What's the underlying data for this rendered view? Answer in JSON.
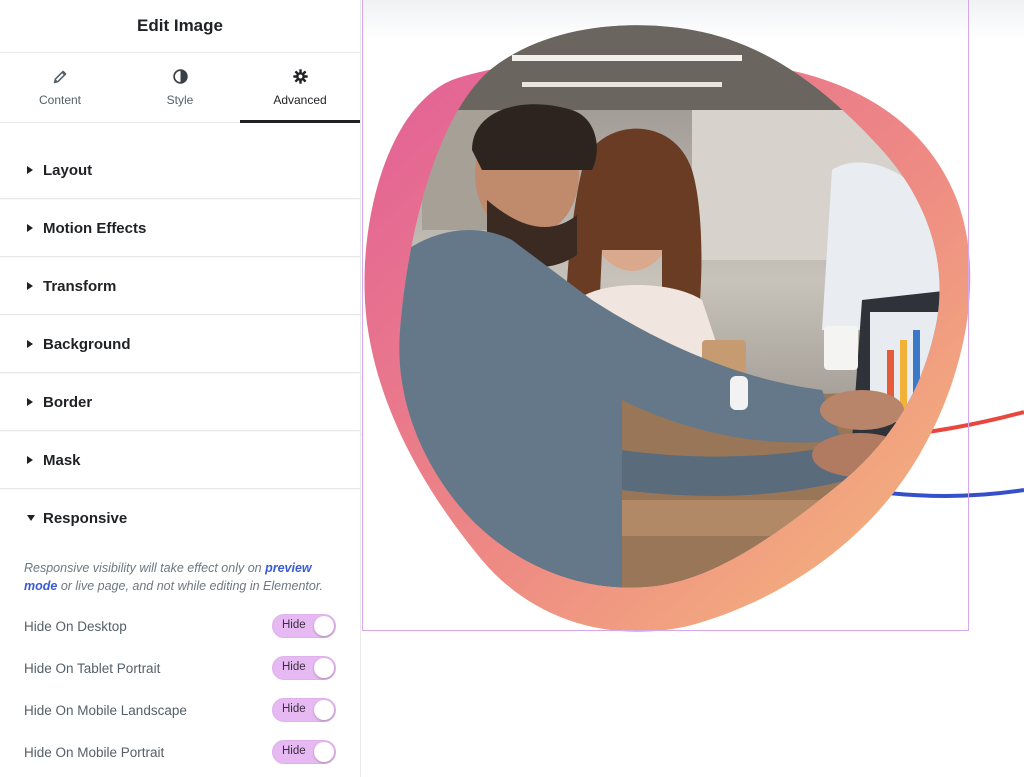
{
  "panel": {
    "title": "Edit Image",
    "tabs": [
      {
        "label": "Content",
        "icon": "pencil-icon"
      },
      {
        "label": "Style",
        "icon": "half-circle-icon"
      },
      {
        "label": "Advanced",
        "icon": "gear-icon",
        "active": true
      }
    ],
    "sections": [
      {
        "label": "Layout",
        "expanded": false
      },
      {
        "label": "Motion Effects",
        "expanded": false
      },
      {
        "label": "Transform",
        "expanded": false
      },
      {
        "label": "Background",
        "expanded": false
      },
      {
        "label": "Border",
        "expanded": false
      },
      {
        "label": "Mask",
        "expanded": false
      },
      {
        "label": "Responsive",
        "expanded": true
      }
    ],
    "responsive": {
      "note_prefix": "Responsive visibility will take effect only on ",
      "note_link": "preview mode",
      "note_suffix": " or live page, and not while editing in Elementor.",
      "toggles": [
        {
          "label": "Hide On Desktop",
          "value": "Hide"
        },
        {
          "label": "Hide On Tablet Portrait",
          "value": "Hide"
        },
        {
          "label": "Hide On Mobile Landscape",
          "value": "Hide"
        },
        {
          "label": "Hide On Mobile Portrait",
          "value": "Hide"
        }
      ]
    }
  },
  "colors": {
    "toggle_on": "#e7b9f2",
    "link": "#3b5bd6",
    "frame": "#d7a7ee",
    "blob_start": "#e56a9a",
    "blob_end": "#f2b27a"
  }
}
